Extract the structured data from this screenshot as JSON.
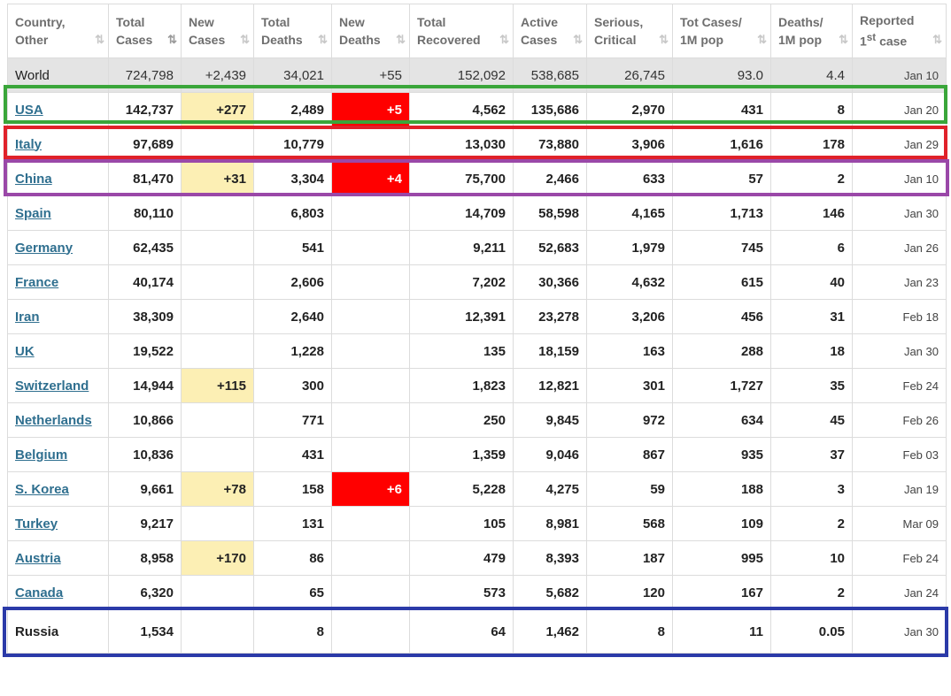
{
  "table": {
    "headers": [
      {
        "line1": "Country,",
        "line2": "Other"
      },
      {
        "line1": "Total",
        "line2": "Cases"
      },
      {
        "line1": "New",
        "line2": "Cases"
      },
      {
        "line1": "Total",
        "line2": "Deaths"
      },
      {
        "line1": "New",
        "line2": "Deaths"
      },
      {
        "line1": "Total",
        "line2": "Recovered"
      },
      {
        "line1": "Active",
        "line2": "Cases"
      },
      {
        "line1": "Serious,",
        "line2": "Critical"
      },
      {
        "line1": "Tot Cases/",
        "line2": "1M pop"
      },
      {
        "line1": "Deaths/",
        "line2": "1M pop"
      },
      {
        "line1": "Reported",
        "line2": "case",
        "sup": "st",
        "prefix": "1"
      }
    ],
    "sort_icon": "⇅",
    "rows": [
      {
        "country": "World",
        "total_cases": "724,798",
        "new_cases": "+2,439",
        "total_deaths": "34,021",
        "new_deaths": "+55",
        "total_recovered": "152,092",
        "active_cases": "538,685",
        "serious_critical": "26,745",
        "tot_cases_1m": "93.0",
        "deaths_1m": "4.4",
        "reported_first": "Jan 10"
      },
      {
        "country": "USA",
        "total_cases": "142,737",
        "new_cases": "+277",
        "total_deaths": "2,489",
        "new_deaths": "+5",
        "total_recovered": "4,562",
        "active_cases": "135,686",
        "serious_critical": "2,970",
        "tot_cases_1m": "431",
        "deaths_1m": "8",
        "reported_first": "Jan 20"
      },
      {
        "country": "Italy",
        "total_cases": "97,689",
        "new_cases": "",
        "total_deaths": "10,779",
        "new_deaths": "",
        "total_recovered": "13,030",
        "active_cases": "73,880",
        "serious_critical": "3,906",
        "tot_cases_1m": "1,616",
        "deaths_1m": "178",
        "reported_first": "Jan 29"
      },
      {
        "country": "China",
        "total_cases": "81,470",
        "new_cases": "+31",
        "total_deaths": "3,304",
        "new_deaths": "+4",
        "total_recovered": "75,700",
        "active_cases": "2,466",
        "serious_critical": "633",
        "tot_cases_1m": "57",
        "deaths_1m": "2",
        "reported_first": "Jan 10"
      },
      {
        "country": "Spain",
        "total_cases": "80,110",
        "new_cases": "",
        "total_deaths": "6,803",
        "new_deaths": "",
        "total_recovered": "14,709",
        "active_cases": "58,598",
        "serious_critical": "4,165",
        "tot_cases_1m": "1,713",
        "deaths_1m": "146",
        "reported_first": "Jan 30"
      },
      {
        "country": "Germany",
        "total_cases": "62,435",
        "new_cases": "",
        "total_deaths": "541",
        "new_deaths": "",
        "total_recovered": "9,211",
        "active_cases": "52,683",
        "serious_critical": "1,979",
        "tot_cases_1m": "745",
        "deaths_1m": "6",
        "reported_first": "Jan 26"
      },
      {
        "country": "France",
        "total_cases": "40,174",
        "new_cases": "",
        "total_deaths": "2,606",
        "new_deaths": "",
        "total_recovered": "7,202",
        "active_cases": "30,366",
        "serious_critical": "4,632",
        "tot_cases_1m": "615",
        "deaths_1m": "40",
        "reported_first": "Jan 23"
      },
      {
        "country": "Iran",
        "total_cases": "38,309",
        "new_cases": "",
        "total_deaths": "2,640",
        "new_deaths": "",
        "total_recovered": "12,391",
        "active_cases": "23,278",
        "serious_critical": "3,206",
        "tot_cases_1m": "456",
        "deaths_1m": "31",
        "reported_first": "Feb 18"
      },
      {
        "country": "UK",
        "total_cases": "19,522",
        "new_cases": "",
        "total_deaths": "1,228",
        "new_deaths": "",
        "total_recovered": "135",
        "active_cases": "18,159",
        "serious_critical": "163",
        "tot_cases_1m": "288",
        "deaths_1m": "18",
        "reported_first": "Jan 30"
      },
      {
        "country": "Switzerland",
        "total_cases": "14,944",
        "new_cases": "+115",
        "total_deaths": "300",
        "new_deaths": "",
        "total_recovered": "1,823",
        "active_cases": "12,821",
        "serious_critical": "301",
        "tot_cases_1m": "1,727",
        "deaths_1m": "35",
        "reported_first": "Feb 24"
      },
      {
        "country": "Netherlands",
        "total_cases": "10,866",
        "new_cases": "",
        "total_deaths": "771",
        "new_deaths": "",
        "total_recovered": "250",
        "active_cases": "9,845",
        "serious_critical": "972",
        "tot_cases_1m": "634",
        "deaths_1m": "45",
        "reported_first": "Feb 26"
      },
      {
        "country": "Belgium",
        "total_cases": "10,836",
        "new_cases": "",
        "total_deaths": "431",
        "new_deaths": "",
        "total_recovered": "1,359",
        "active_cases": "9,046",
        "serious_critical": "867",
        "tot_cases_1m": "935",
        "deaths_1m": "37",
        "reported_first": "Feb 03"
      },
      {
        "country": "S. Korea",
        "total_cases": "9,661",
        "new_cases": "+78",
        "total_deaths": "158",
        "new_deaths": "+6",
        "total_recovered": "5,228",
        "active_cases": "4,275",
        "serious_critical": "59",
        "tot_cases_1m": "188",
        "deaths_1m": "3",
        "reported_first": "Jan 19"
      },
      {
        "country": "Turkey",
        "total_cases": "9,217",
        "new_cases": "",
        "total_deaths": "131",
        "new_deaths": "",
        "total_recovered": "105",
        "active_cases": "8,981",
        "serious_critical": "568",
        "tot_cases_1m": "109",
        "deaths_1m": "2",
        "reported_first": "Mar 09"
      },
      {
        "country": "Austria",
        "total_cases": "8,958",
        "new_cases": "+170",
        "total_deaths": "86",
        "new_deaths": "",
        "total_recovered": "479",
        "active_cases": "8,393",
        "serious_critical": "187",
        "tot_cases_1m": "995",
        "deaths_1m": "10",
        "reported_first": "Feb 24"
      },
      {
        "country": "Canada",
        "total_cases": "6,320",
        "new_cases": "",
        "total_deaths": "65",
        "new_deaths": "",
        "total_recovered": "573",
        "active_cases": "5,682",
        "serious_critical": "120",
        "tot_cases_1m": "167",
        "deaths_1m": "2",
        "reported_first": "Jan 24"
      },
      {
        "country": "Russia",
        "total_cases": "1,534",
        "new_cases": "",
        "total_deaths": "8",
        "new_deaths": "",
        "total_recovered": "64",
        "active_cases": "1,462",
        "serious_critical": "8",
        "tot_cases_1m": "11",
        "deaths_1m": "0.05",
        "reported_first": "Jan 30"
      }
    ]
  },
  "highlight_boxes": [
    {
      "row": "USA",
      "color": "#3aa63a"
    },
    {
      "row": "Italy",
      "color": "#e0212a"
    },
    {
      "row": "China",
      "color": "#9a48a8"
    },
    {
      "row": "Russia",
      "color": "#2b3aa8"
    }
  ],
  "colors": {
    "new_cases_highlight": "#fcefb4",
    "new_deaths_highlight": "#ff0000",
    "world_row_bg": "#e4e4e4",
    "link": "#2f6f8f"
  }
}
